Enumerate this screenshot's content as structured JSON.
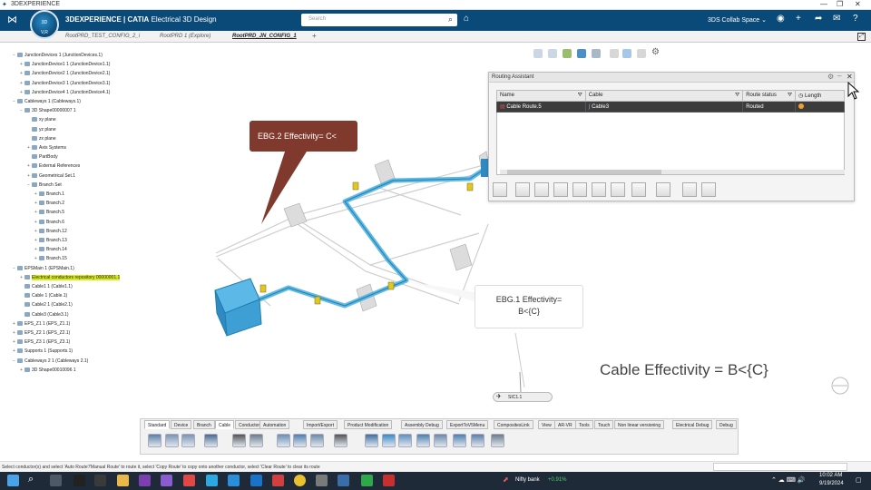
{
  "window": {
    "title": "3DEXPERIENCE",
    "controls": [
      "—",
      "❐",
      "✕"
    ]
  },
  "topbar": {
    "brand_bold": "3DEXPERIENCE | CATIA",
    "brand_app": "Electrical 3D Design",
    "compass_top": "3D",
    "compass_bottom": "V,R",
    "search_placeholder": "Search",
    "collab_space": "3DS Collab Space ⌄"
  },
  "tabs": [
    {
      "label": "RootPRD_TEST_CONFIG_2_i",
      "active": false
    },
    {
      "label": "RootPRD 1 (Explore)",
      "active": false
    },
    {
      "label": "RootPRD_JN_CONFIG_1",
      "active": true
    },
    {
      "label": "+",
      "active": false
    }
  ],
  "tree": [
    {
      "label": "JunctionDevices 1 (JunctionDevices.1)",
      "level": 0,
      "pm": "−"
    },
    {
      "label": "JunctionDevice1 1 (JunctionDevice1.1)",
      "level": 1,
      "pm": "+"
    },
    {
      "label": "JunctionDevice2 1 (JunctionDevice2.1)",
      "level": 1,
      "pm": "+"
    },
    {
      "label": "JunctionDevice3 1 (JunctionDevice3.1)",
      "level": 1,
      "pm": "+"
    },
    {
      "label": "JunctionDevice4 1 (JunctionDevice4.1)",
      "level": 1,
      "pm": "+"
    },
    {
      "label": "Cableways 1 (Cableways.1)",
      "level": 0,
      "pm": "−"
    },
    {
      "label": "3D Shape00000007 1",
      "level": 1,
      "pm": "−"
    },
    {
      "label": "xy plane",
      "level": 2,
      "pm": ""
    },
    {
      "label": "yz plane",
      "level": 2,
      "pm": ""
    },
    {
      "label": "zx plane",
      "level": 2,
      "pm": ""
    },
    {
      "label": "Axis Systems",
      "level": 2,
      "pm": "+"
    },
    {
      "label": "PartBody",
      "level": 2,
      "pm": ""
    },
    {
      "label": "External References",
      "level": 2,
      "pm": "+"
    },
    {
      "label": "Geometrical Set.1",
      "level": 2,
      "pm": "+"
    },
    {
      "label": "Branch Set",
      "level": 2,
      "pm": "−"
    },
    {
      "label": "Branch.1",
      "level": 3,
      "pm": "+"
    },
    {
      "label": "Branch.2",
      "level": 3,
      "pm": "+"
    },
    {
      "label": "Branch.5",
      "level": 3,
      "pm": "+"
    },
    {
      "label": "Branch.6",
      "level": 3,
      "pm": "+"
    },
    {
      "label": "Branch.12",
      "level": 3,
      "pm": "+"
    },
    {
      "label": "Branch.13",
      "level": 3,
      "pm": "+"
    },
    {
      "label": "Branch.14",
      "level": 3,
      "pm": "+"
    },
    {
      "label": "Branch.15",
      "level": 3,
      "pm": "+"
    },
    {
      "label": "EPSMain 1 (EPSMain.1)",
      "level": 0,
      "pm": "−"
    },
    {
      "label": "Electrical conductors repository 00000001.1",
      "level": 1,
      "pm": "+",
      "highlight": true
    },
    {
      "label": "Cable1 1 (Cable1.1)",
      "level": 1,
      "pm": ""
    },
    {
      "label": "Cable 1 (Cable.1)",
      "level": 1,
      "pm": ""
    },
    {
      "label": "Cable2 1 (Cable2.1)",
      "level": 1,
      "pm": ""
    },
    {
      "label": "Cable3 (Cable3.1)",
      "level": 1,
      "pm": ""
    },
    {
      "label": "EPS_Z1 1 (EPS_Z1.1)",
      "level": 0,
      "pm": "+"
    },
    {
      "label": "EPS_Z2 1 (EPS_Z2.1)",
      "level": 0,
      "pm": "+"
    },
    {
      "label": "EPS_Z3 1 (EPS_Z3.1)",
      "level": 0,
      "pm": "+"
    },
    {
      "label": "Supports 1 (Supports.1)",
      "level": 0,
      "pm": "+"
    },
    {
      "label": "Cableways 2 1 (Cableways 2.1)",
      "level": 0,
      "pm": "−"
    },
    {
      "label": "3D Shape00010096 1",
      "level": 1,
      "pm": "+"
    }
  ],
  "routing_assistant": {
    "title": "Routing Assistant",
    "columns": [
      "Name",
      "Cable",
      "Route status",
      "Length"
    ],
    "rows": [
      {
        "name": "Cable Route.5",
        "cable": "Cable3",
        "status": "Routed",
        "length": ""
      }
    ]
  },
  "canvas": {
    "callout1": "EBG.2 Effectivity= C<",
    "callout2_line1": "EBG.1 Effectivity=",
    "callout2_line2": "B<{C}",
    "big_text": "Cable Effectivity = B<{C}",
    "sic_label": "SIC1.1"
  },
  "bottom_tabs": [
    {
      "label": "Standard",
      "active": true
    },
    {
      "label": "Device",
      "active": false
    },
    {
      "label": "Branch",
      "active": false
    },
    {
      "label": "Cable",
      "active": true
    },
    {
      "label": "Conductors",
      "active": false
    },
    {
      "label": "Automation",
      "active": false
    },
    {
      "label": "Import/Export",
      "active": false
    },
    {
      "label": "Product Modification",
      "active": false
    },
    {
      "label": "Assembly Debug",
      "active": false
    },
    {
      "label": "ExportToV5Menu",
      "active": false
    },
    {
      "label": "CompositesLink",
      "active": false
    },
    {
      "label": "View",
      "active": false
    },
    {
      "label": "AR-VR",
      "active": false
    },
    {
      "label": "Tools",
      "active": false
    },
    {
      "label": "Touch",
      "active": false
    },
    {
      "label": "Non linear versioning",
      "active": false
    },
    {
      "label": "Electrical Debug",
      "active": false
    },
    {
      "label": "Debug",
      "active": false
    }
  ],
  "status_text": "Select conductor(s) and select 'Auto Route'/'Manual Route' to route it, select 'Copy Route' to copy onto another conductor, select 'Clear Route' to clear its route",
  "taskbar": {
    "stock_name": "Nifty bank",
    "stock_change": "+0.91%",
    "time": "10:02 AM",
    "date": "9/19/2024"
  },
  "colors": {
    "topbar": "#0a4a78",
    "callout1": "#7f3a2d",
    "cableway": "#4fb3e0",
    "highlight": "#d8ec1c"
  }
}
